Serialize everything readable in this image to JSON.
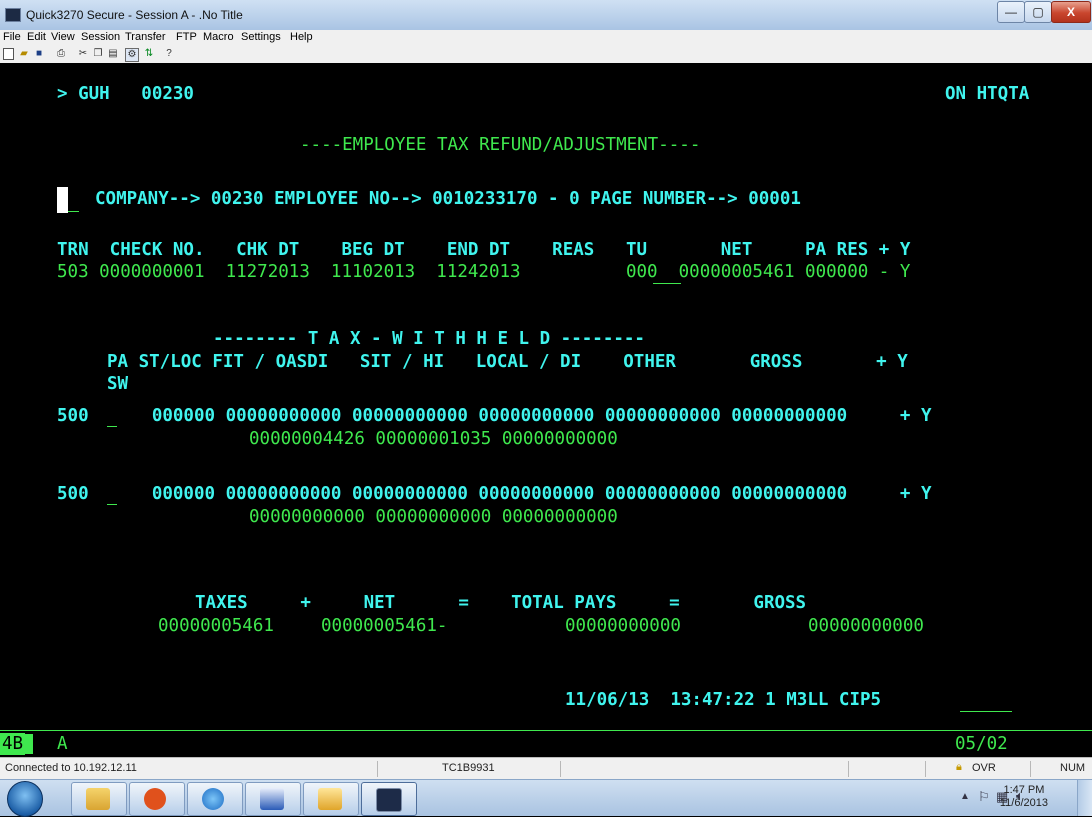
{
  "window": {
    "title": "Quick3270 Secure - Session A - .No Title",
    "min_glyph": "—",
    "max_glyph": "▢",
    "close_glyph": "X"
  },
  "menu": [
    "File",
    "Edit",
    "View",
    "Session",
    "Transfer",
    "FTP",
    "Macro",
    "Settings",
    "Help"
  ],
  "toolbar": [
    "new-icon",
    "open-icon",
    "save-icon",
    "print-icon",
    "cut-icon",
    "copy-icon",
    "paste-icon",
    "macro-icon",
    "transfer-icon",
    "help-icon"
  ],
  "screen": {
    "header_left": "> GUH   00230",
    "header_right": "ON HTQTA",
    "title": "----EMPLOYEE TAX REFUND/ADJUSTMENT----",
    "company_line": "COMPANY--> 00230 EMPLOYEE NO--> 0010233170 - 0 PAGE NUMBER--> 00001",
    "check_header": "TRN  CHECK NO.   CHK DT    BEG DT    END DT    REAS   TU       NET     PA RES + Y",
    "check_row": "503 0000000001  11272013  11102013  11242013          000  00000005461 000000 - Y",
    "tax_heading": "-------- T A X - W I T H H E L D --------",
    "tax_header1": "PA ST/LOC FIT / OASDI   SIT / HI   LOCAL / DI    OTHER       GROSS       + Y",
    "tax_header2": "SW",
    "row1_line1": "500      000000 00000000000 00000000000 00000000000 00000000000 00000000000     + Y",
    "row1_line2": "00000004426 00000001035 00000000000",
    "row2_line1": "500      000000 00000000000 00000000000 00000000000 00000000000 00000000000     + Y",
    "row2_line2": "00000000000 00000000000 00000000000",
    "totals_labels": "TAXES     +     NET      =    TOTAL PAYS     =       GROSS",
    "taxes": "00000005461",
    "net": "00000005461-",
    "total_pays": "00000000000",
    "gross": "00000000000",
    "footer": "11/06/13  13:47:22 1 M3LL CIP5",
    "colors": {
      "green": "#3fe84e",
      "cyan": "#40f4ee"
    }
  },
  "oia": {
    "left": "4B",
    "mode": "A",
    "cursor_pos": "05/02"
  },
  "status": {
    "connection": "Connected to 10.192.12.11",
    "terminal": "TC1B9931",
    "ovr": "OVR",
    "num": "NUM"
  },
  "taskbar": {
    "apps": [
      "windows-explorer-icon",
      "office-app-icon",
      "internet-explorer-icon",
      "word-icon",
      "outlook-icon",
      "quick3270-icon"
    ],
    "time": "1:47 PM",
    "date": "11/6/2013"
  }
}
